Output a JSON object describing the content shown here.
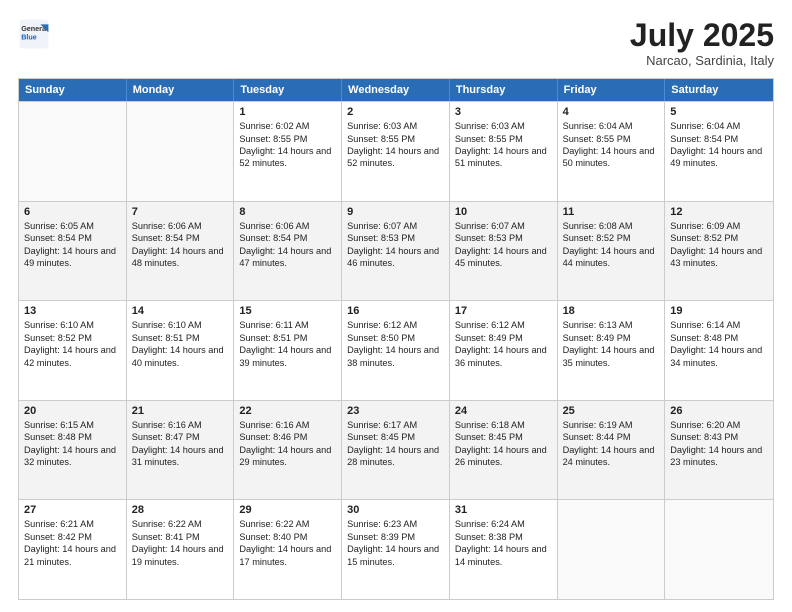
{
  "header": {
    "logo_general": "General",
    "logo_blue": "Blue",
    "month_year": "July 2025",
    "location": "Narcao, Sardinia, Italy"
  },
  "days_of_week": [
    "Sunday",
    "Monday",
    "Tuesday",
    "Wednesday",
    "Thursday",
    "Friday",
    "Saturday"
  ],
  "weeks": [
    [
      {
        "day": "",
        "sunrise": "",
        "sunset": "",
        "daylight": "",
        "empty": true
      },
      {
        "day": "",
        "sunrise": "",
        "sunset": "",
        "daylight": "",
        "empty": true
      },
      {
        "day": "1",
        "sunrise": "Sunrise: 6:02 AM",
        "sunset": "Sunset: 8:55 PM",
        "daylight": "Daylight: 14 hours and 52 minutes.",
        "empty": false
      },
      {
        "day": "2",
        "sunrise": "Sunrise: 6:03 AM",
        "sunset": "Sunset: 8:55 PM",
        "daylight": "Daylight: 14 hours and 52 minutes.",
        "empty": false
      },
      {
        "day": "3",
        "sunrise": "Sunrise: 6:03 AM",
        "sunset": "Sunset: 8:55 PM",
        "daylight": "Daylight: 14 hours and 51 minutes.",
        "empty": false
      },
      {
        "day": "4",
        "sunrise": "Sunrise: 6:04 AM",
        "sunset": "Sunset: 8:55 PM",
        "daylight": "Daylight: 14 hours and 50 minutes.",
        "empty": false
      },
      {
        "day": "5",
        "sunrise": "Sunrise: 6:04 AM",
        "sunset": "Sunset: 8:54 PM",
        "daylight": "Daylight: 14 hours and 49 minutes.",
        "empty": false
      }
    ],
    [
      {
        "day": "6",
        "sunrise": "Sunrise: 6:05 AM",
        "sunset": "Sunset: 8:54 PM",
        "daylight": "Daylight: 14 hours and 49 minutes.",
        "empty": false
      },
      {
        "day": "7",
        "sunrise": "Sunrise: 6:06 AM",
        "sunset": "Sunset: 8:54 PM",
        "daylight": "Daylight: 14 hours and 48 minutes.",
        "empty": false
      },
      {
        "day": "8",
        "sunrise": "Sunrise: 6:06 AM",
        "sunset": "Sunset: 8:54 PM",
        "daylight": "Daylight: 14 hours and 47 minutes.",
        "empty": false
      },
      {
        "day": "9",
        "sunrise": "Sunrise: 6:07 AM",
        "sunset": "Sunset: 8:53 PM",
        "daylight": "Daylight: 14 hours and 46 minutes.",
        "empty": false
      },
      {
        "day": "10",
        "sunrise": "Sunrise: 6:07 AM",
        "sunset": "Sunset: 8:53 PM",
        "daylight": "Daylight: 14 hours and 45 minutes.",
        "empty": false
      },
      {
        "day": "11",
        "sunrise": "Sunrise: 6:08 AM",
        "sunset": "Sunset: 8:52 PM",
        "daylight": "Daylight: 14 hours and 44 minutes.",
        "empty": false
      },
      {
        "day": "12",
        "sunrise": "Sunrise: 6:09 AM",
        "sunset": "Sunset: 8:52 PM",
        "daylight": "Daylight: 14 hours and 43 minutes.",
        "empty": false
      }
    ],
    [
      {
        "day": "13",
        "sunrise": "Sunrise: 6:10 AM",
        "sunset": "Sunset: 8:52 PM",
        "daylight": "Daylight: 14 hours and 42 minutes.",
        "empty": false
      },
      {
        "day": "14",
        "sunrise": "Sunrise: 6:10 AM",
        "sunset": "Sunset: 8:51 PM",
        "daylight": "Daylight: 14 hours and 40 minutes.",
        "empty": false
      },
      {
        "day": "15",
        "sunrise": "Sunrise: 6:11 AM",
        "sunset": "Sunset: 8:51 PM",
        "daylight": "Daylight: 14 hours and 39 minutes.",
        "empty": false
      },
      {
        "day": "16",
        "sunrise": "Sunrise: 6:12 AM",
        "sunset": "Sunset: 8:50 PM",
        "daylight": "Daylight: 14 hours and 38 minutes.",
        "empty": false
      },
      {
        "day": "17",
        "sunrise": "Sunrise: 6:12 AM",
        "sunset": "Sunset: 8:49 PM",
        "daylight": "Daylight: 14 hours and 36 minutes.",
        "empty": false
      },
      {
        "day": "18",
        "sunrise": "Sunrise: 6:13 AM",
        "sunset": "Sunset: 8:49 PM",
        "daylight": "Daylight: 14 hours and 35 minutes.",
        "empty": false
      },
      {
        "day": "19",
        "sunrise": "Sunrise: 6:14 AM",
        "sunset": "Sunset: 8:48 PM",
        "daylight": "Daylight: 14 hours and 34 minutes.",
        "empty": false
      }
    ],
    [
      {
        "day": "20",
        "sunrise": "Sunrise: 6:15 AM",
        "sunset": "Sunset: 8:48 PM",
        "daylight": "Daylight: 14 hours and 32 minutes.",
        "empty": false
      },
      {
        "day": "21",
        "sunrise": "Sunrise: 6:16 AM",
        "sunset": "Sunset: 8:47 PM",
        "daylight": "Daylight: 14 hours and 31 minutes.",
        "empty": false
      },
      {
        "day": "22",
        "sunrise": "Sunrise: 6:16 AM",
        "sunset": "Sunset: 8:46 PM",
        "daylight": "Daylight: 14 hours and 29 minutes.",
        "empty": false
      },
      {
        "day": "23",
        "sunrise": "Sunrise: 6:17 AM",
        "sunset": "Sunset: 8:45 PM",
        "daylight": "Daylight: 14 hours and 28 minutes.",
        "empty": false
      },
      {
        "day": "24",
        "sunrise": "Sunrise: 6:18 AM",
        "sunset": "Sunset: 8:45 PM",
        "daylight": "Daylight: 14 hours and 26 minutes.",
        "empty": false
      },
      {
        "day": "25",
        "sunrise": "Sunrise: 6:19 AM",
        "sunset": "Sunset: 8:44 PM",
        "daylight": "Daylight: 14 hours and 24 minutes.",
        "empty": false
      },
      {
        "day": "26",
        "sunrise": "Sunrise: 6:20 AM",
        "sunset": "Sunset: 8:43 PM",
        "daylight": "Daylight: 14 hours and 23 minutes.",
        "empty": false
      }
    ],
    [
      {
        "day": "27",
        "sunrise": "Sunrise: 6:21 AM",
        "sunset": "Sunset: 8:42 PM",
        "daylight": "Daylight: 14 hours and 21 minutes.",
        "empty": false
      },
      {
        "day": "28",
        "sunrise": "Sunrise: 6:22 AM",
        "sunset": "Sunset: 8:41 PM",
        "daylight": "Daylight: 14 hours and 19 minutes.",
        "empty": false
      },
      {
        "day": "29",
        "sunrise": "Sunrise: 6:22 AM",
        "sunset": "Sunset: 8:40 PM",
        "daylight": "Daylight: 14 hours and 17 minutes.",
        "empty": false
      },
      {
        "day": "30",
        "sunrise": "Sunrise: 6:23 AM",
        "sunset": "Sunset: 8:39 PM",
        "daylight": "Daylight: 14 hours and 15 minutes.",
        "empty": false
      },
      {
        "day": "31",
        "sunrise": "Sunrise: 6:24 AM",
        "sunset": "Sunset: 8:38 PM",
        "daylight": "Daylight: 14 hours and 14 minutes.",
        "empty": false
      },
      {
        "day": "",
        "sunrise": "",
        "sunset": "",
        "daylight": "",
        "empty": true
      },
      {
        "day": "",
        "sunrise": "",
        "sunset": "",
        "daylight": "",
        "empty": true
      }
    ]
  ]
}
